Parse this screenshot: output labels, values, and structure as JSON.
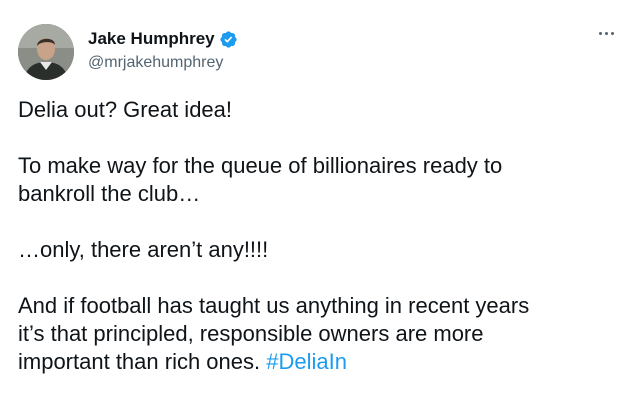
{
  "author": {
    "display_name": "Jake Humphrey",
    "handle": "@mrjakehumphrey",
    "verified": true,
    "avatar": "profile-photo"
  },
  "tweet": {
    "paragraph_1": "Delia out? Great idea!",
    "paragraph_2": "To make way for the queue of billionaires ready to\nbankroll the club…",
    "paragraph_3": "…only, there aren’t any!!!!",
    "paragraph_4": "And if football has taught us anything in recent years\nit’s that principled, responsible owners are more\nimportant than rich ones. ",
    "hashtag": "#DeliaIn"
  },
  "icons": {
    "verified": "verified-badge-icon",
    "more": "more-options-icon"
  },
  "colors": {
    "text": "#0f1419",
    "secondary": "#536471",
    "accent": "#1d9bf0",
    "background": "#ffffff"
  }
}
